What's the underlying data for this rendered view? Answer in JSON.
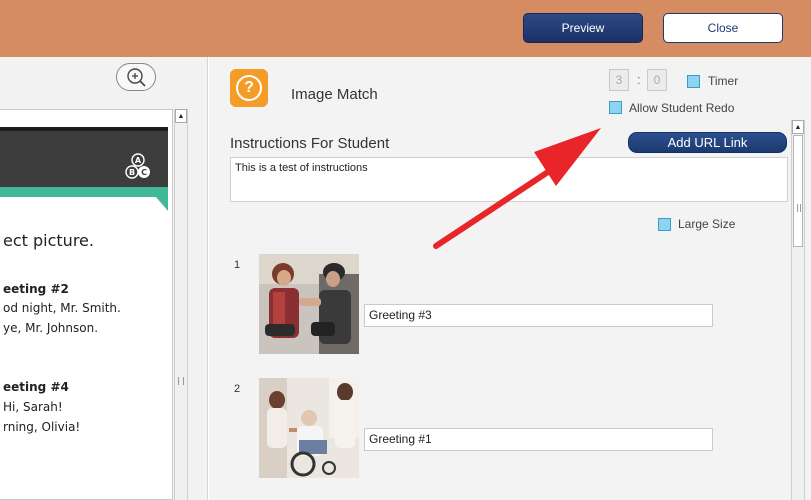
{
  "toolbar": {
    "preview_label": "Preview",
    "close_label": "Close"
  },
  "activity": {
    "title": "Image Match",
    "timer_minutes": "3",
    "timer_seconds": "0",
    "timer_label": "Timer",
    "allow_redo_label": "Allow Student Redo",
    "instructions_label": "Instructions For Student",
    "add_url_label": "Add URL Link",
    "instructions_text": "This is a test of instructions",
    "large_size_label": "Large Size"
  },
  "preview_doc": {
    "instruction_fragment": "ect picture.",
    "g2_title": "eeting #2",
    "g2_line1": "od night, Mr. Smith.",
    "g2_line2": "ye, Mr. Johnson.",
    "g4_title": "eeting #4",
    "g4_line1": "Hi, Sarah!",
    "g4_line2": "rning, Olivia!"
  },
  "items": [
    {
      "number": "1",
      "answer": "Greeting #3"
    },
    {
      "number": "2",
      "answer": "Greeting #1"
    }
  ],
  "colors": {
    "topbar": "#d48c60",
    "preview_button": "#1f3a70",
    "app_icon": "#f39c28",
    "checkbox": "#8cd4ef",
    "arrow": "#e8262a",
    "teal_bar": "#42b89a"
  }
}
